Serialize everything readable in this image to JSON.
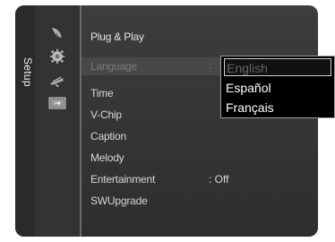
{
  "sidebar": {
    "title": "Setup",
    "icons": [
      "satellite-dish-icon",
      "gear-icon",
      "antenna-icon",
      "tv-input-icon"
    ]
  },
  "menu": {
    "items": [
      {
        "label": "Plug & Play",
        "value": ""
      },
      {
        "label": "Language",
        "value": ":"
      },
      {
        "label": "Time",
        "value": ""
      },
      {
        "label": "V-Chip",
        "value": ""
      },
      {
        "label": "Caption",
        "value": ""
      },
      {
        "label": "Melody",
        "value": ""
      },
      {
        "label": "Entertainment",
        "value": ": Off"
      },
      {
        "label": "SWUpgrade",
        "value": ""
      }
    ]
  },
  "dropdown": {
    "options": [
      "English",
      "Español",
      "Français"
    ],
    "selected": "English"
  },
  "colors": {
    "panel": "#353535",
    "text": "#d6d6d6",
    "highlight_row": "#484848",
    "dropdown_bg": "#000000"
  }
}
